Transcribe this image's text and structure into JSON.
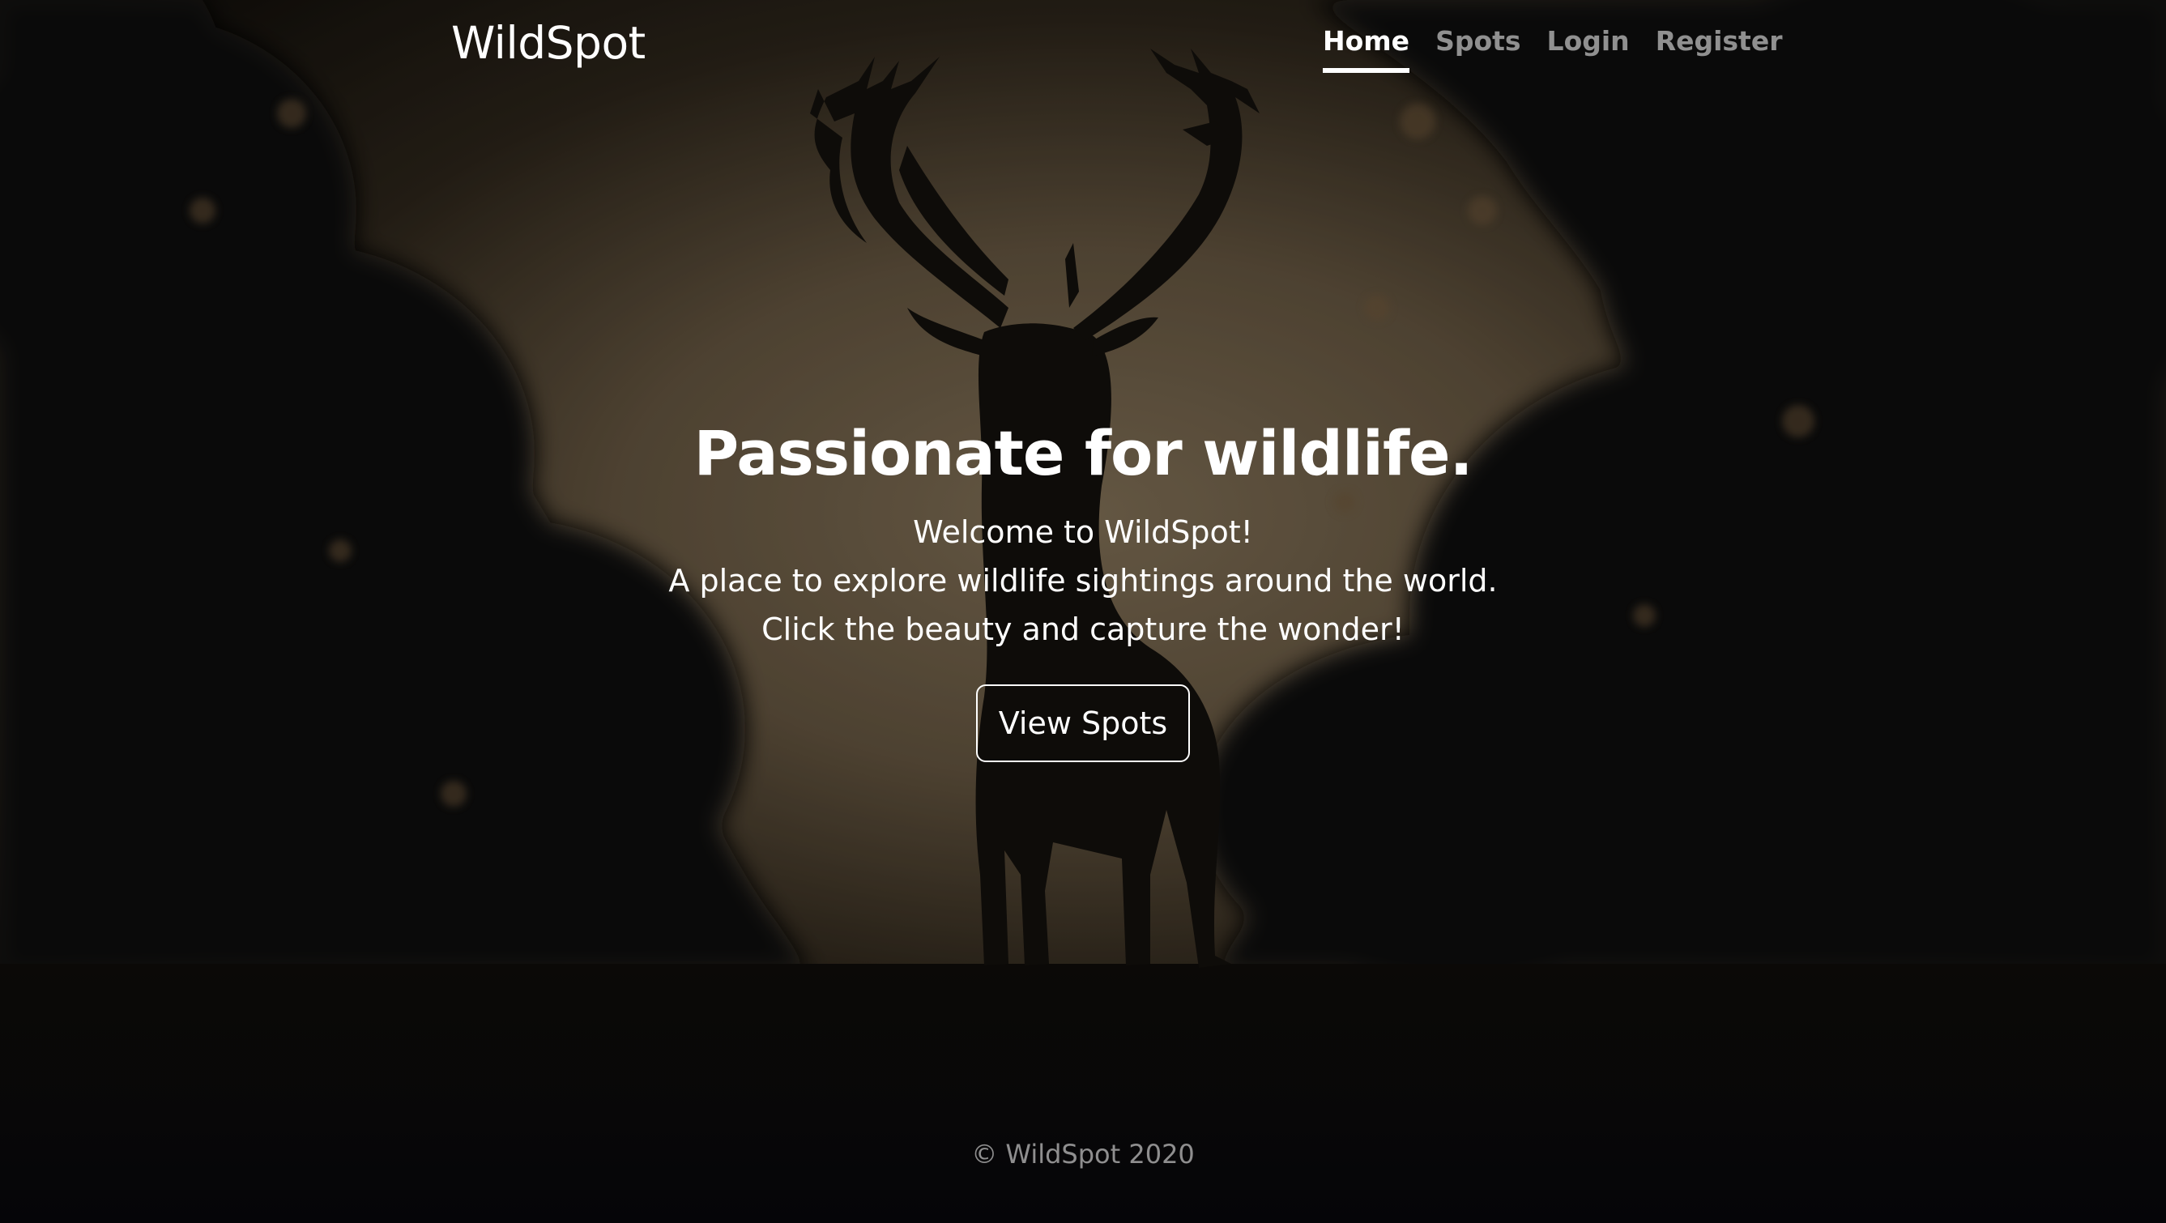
{
  "brand": "WildSpot",
  "nav": {
    "items": [
      {
        "label": "Home",
        "active": true
      },
      {
        "label": "Spots",
        "active": false
      },
      {
        "label": "Login",
        "active": false
      },
      {
        "label": "Register",
        "active": false
      }
    ]
  },
  "hero": {
    "title": "Passionate for wildlife.",
    "lines": [
      "Welcome to WildSpot!",
      "A place to explore wildlife sightings around the world.",
      "Click the beauty and capture the wonder!"
    ],
    "button_label": "View Spots"
  },
  "footer": {
    "text": "© WildSpot 2020"
  },
  "background": {
    "subject": "stag silhouette at dusk",
    "sky_color": "#6e5e48",
    "foliage_color": "#120f0a"
  }
}
